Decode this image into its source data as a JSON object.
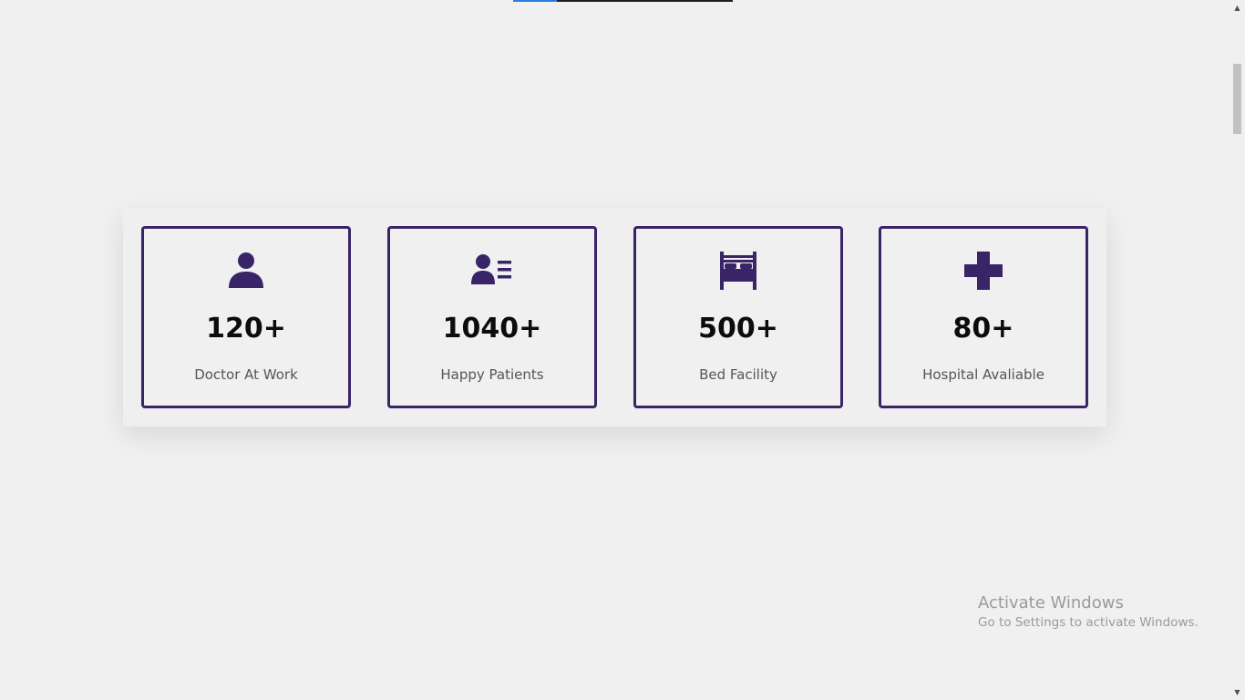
{
  "colors": {
    "background": "#f0f0f0",
    "accent": "#3a2468",
    "progress_fill": "#2b7de0",
    "progress_track": "#1f1f1f",
    "value_text": "#0c0c0c",
    "label_text": "#555555"
  },
  "top_progress": {
    "fill_fraction": 0.2
  },
  "stats": [
    {
      "icon": "user-icon",
      "value": "120+",
      "label": "Doctor At Work"
    },
    {
      "icon": "patient-list-icon",
      "value": "1040+",
      "label": "Happy Patients"
    },
    {
      "icon": "bed-icon",
      "value": "500+",
      "label": "Bed Facility"
    },
    {
      "icon": "plus-icon",
      "value": "80+",
      "label": "Hospital Avaliable"
    }
  ],
  "scrollbar": {
    "up_glyph": "▲",
    "down_glyph": "▼"
  },
  "watermark": {
    "title": "Activate Windows",
    "subtitle": "Go to Settings to activate Windows."
  }
}
